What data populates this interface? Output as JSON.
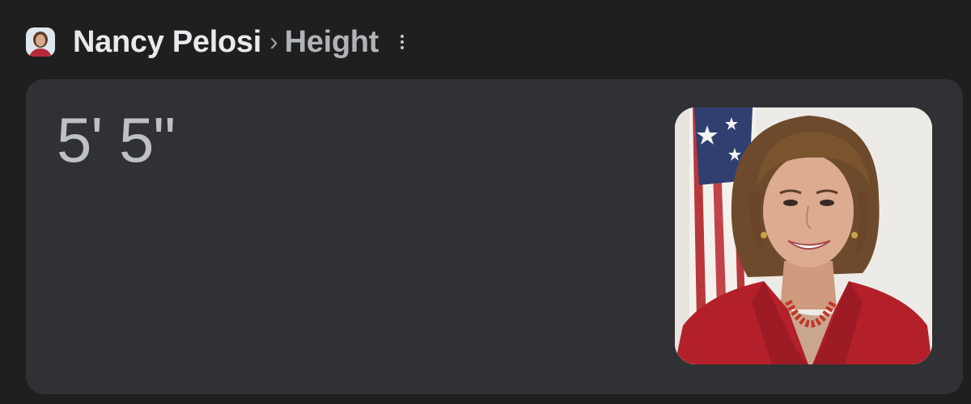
{
  "header": {
    "entity_name": "Nancy Pelosi",
    "separator": "›",
    "attribute": "Height",
    "more_icon": "more-vert-icon",
    "avatar_icon": "person-avatar"
  },
  "answer": {
    "value": "5' 5\""
  },
  "colors": {
    "background": "#1f1f1f",
    "card": "#303134",
    "title_text": "#e8eaed",
    "attribute_text": "#b0b3b8",
    "answer_text": "#bdc1c6",
    "jacket_red": "#b3202a"
  }
}
